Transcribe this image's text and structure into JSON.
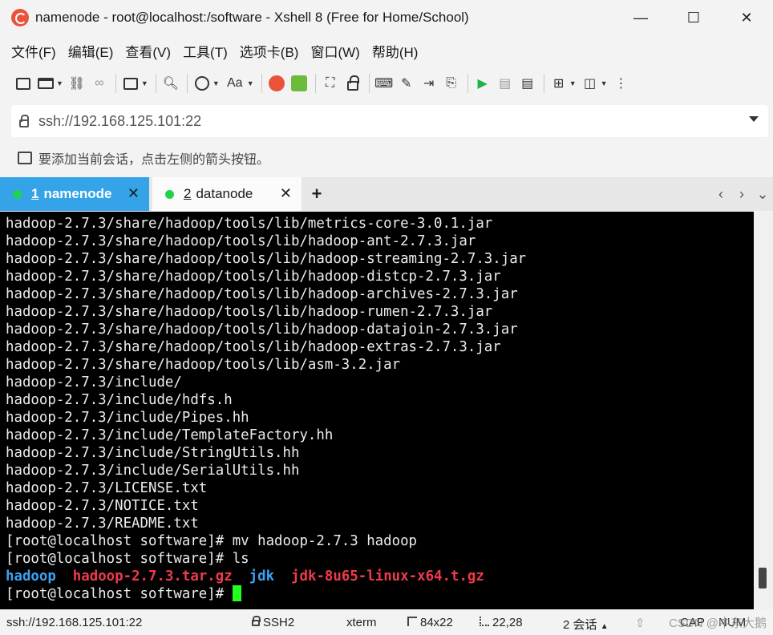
{
  "window": {
    "title": "namenode - root@localhost:/software - Xshell 8 (Free for Home/School)",
    "minimize": "—",
    "maximize": "☐",
    "close": "✕"
  },
  "menu": [
    "文件(F)",
    "编辑(E)",
    "查看(V)",
    "工具(T)",
    "选项卡(B)",
    "窗口(W)",
    "帮助(H)"
  ],
  "toolbar": {
    "font_label": "Aa"
  },
  "address": {
    "value": "ssh://192.168.125.101:22"
  },
  "hint": {
    "text": "要添加当前会话，点击左侧的箭头按钮。"
  },
  "tabs": [
    {
      "num": "1",
      "label": "namenode",
      "active": true,
      "close": "✕"
    },
    {
      "num": "2",
      "label": "datanode",
      "active": false,
      "close": "✕"
    }
  ],
  "tab_add": "+",
  "tab_nav": {
    "prev": "‹",
    "next": "›",
    "menu": "⌄"
  },
  "terminal": {
    "lines": [
      "hadoop-2.7.3/share/hadoop/tools/lib/metrics-core-3.0.1.jar",
      "hadoop-2.7.3/share/hadoop/tools/lib/hadoop-ant-2.7.3.jar",
      "hadoop-2.7.3/share/hadoop/tools/lib/hadoop-streaming-2.7.3.jar",
      "hadoop-2.7.3/share/hadoop/tools/lib/hadoop-distcp-2.7.3.jar",
      "hadoop-2.7.3/share/hadoop/tools/lib/hadoop-archives-2.7.3.jar",
      "hadoop-2.7.3/share/hadoop/tools/lib/hadoop-rumen-2.7.3.jar",
      "hadoop-2.7.3/share/hadoop/tools/lib/hadoop-datajoin-2.7.3.jar",
      "hadoop-2.7.3/share/hadoop/tools/lib/hadoop-extras-2.7.3.jar",
      "hadoop-2.7.3/share/hadoop/tools/lib/asm-3.2.jar",
      "hadoop-2.7.3/include/",
      "hadoop-2.7.3/include/hdfs.h",
      "hadoop-2.7.3/include/Pipes.hh",
      "hadoop-2.7.3/include/TemplateFactory.hh",
      "hadoop-2.7.3/include/StringUtils.hh",
      "hadoop-2.7.3/include/SerialUtils.hh",
      "hadoop-2.7.3/LICENSE.txt",
      "hadoop-2.7.3/NOTICE.txt",
      "hadoop-2.7.3/README.txt",
      "[root@localhost software]# mv hadoop-2.7.3 hadoop",
      "[root@localhost software]# ls"
    ],
    "ls_output": [
      {
        "name": "hadoop",
        "color": "#3ba3f5"
      },
      {
        "name": "hadoop-2.7.3.tar.gz",
        "color": "#ef3a4b"
      },
      {
        "name": "jdk",
        "color": "#3ba3f5"
      },
      {
        "name": "jdk-8u65-linux-x64.t.gz",
        "color": "#ef3a4b"
      }
    ],
    "prompt": "[root@localhost software]# ",
    "cursor_color": "#21ff21",
    "background": "#000000"
  },
  "statusbar": {
    "connection": "ssh://192.168.125.101:22",
    "protocol": "SSH2",
    "term": "xterm",
    "size": "84x22",
    "position": "22,28",
    "sessions": "2 会话",
    "caps": "CAP",
    "num": "NUM",
    "watermark": "CSDN @中东大鹅"
  },
  "colors": {
    "active_tab": "#34a3e8",
    "status_dot": "#1fd44a"
  }
}
